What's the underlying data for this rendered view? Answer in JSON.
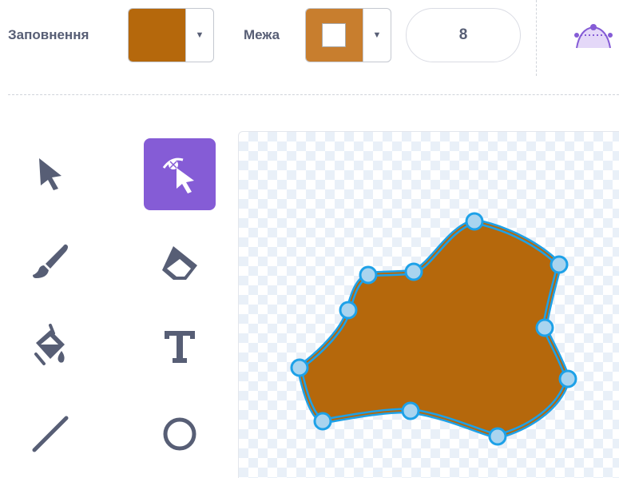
{
  "toolbar": {
    "fill": {
      "label": "Заповнення",
      "color": "#b5680c"
    },
    "outline": {
      "label": "Межа",
      "color": "#c87e2e"
    },
    "stroke_width": "8"
  },
  "colors": {
    "tool_icon": "#575e75",
    "active_tool_bg": "#855cd6",
    "shape_fill": "#b5680c",
    "selection_outline": "#1da1e8",
    "handle_fill": "#a9d4ef"
  },
  "tools": [
    {
      "name": "select-tool",
      "icon": "arrow-cursor-icon",
      "active": false
    },
    {
      "name": "reshape-tool",
      "icon": "reshape-icon",
      "active": true
    },
    {
      "name": "brush-tool",
      "icon": "brush-icon",
      "active": false
    },
    {
      "name": "eraser-tool",
      "icon": "eraser-icon",
      "active": false
    },
    {
      "name": "fill-tool",
      "icon": "paint-bucket-icon",
      "active": false
    },
    {
      "name": "text-tool",
      "icon": "text-icon",
      "active": false
    },
    {
      "name": "line-tool",
      "icon": "line-icon",
      "active": false
    },
    {
      "name": "circle-tool",
      "icon": "circle-icon",
      "active": false
    }
  ]
}
